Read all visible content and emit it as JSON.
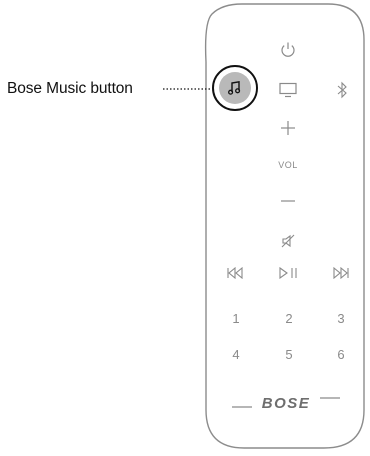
{
  "callout": {
    "label": "Bose Music button"
  },
  "remote": {
    "icons": {
      "power": "power-icon",
      "music": "music-note-icon",
      "tv": "tv-icon",
      "bluetooth": "bluetooth-icon",
      "volume_up": "plus-icon",
      "volume_down": "minus-icon",
      "mute": "mute-icon",
      "previous": "skip-back-icon",
      "play_pause": "play-pause-icon",
      "next": "skip-forward-icon"
    },
    "vol_label": "VOL",
    "presets": [
      "1",
      "2",
      "3",
      "4",
      "5",
      "6"
    ],
    "brand": "BOSE"
  },
  "colors": {
    "outline": "#8c8c8c",
    "icon": "#8a8a8a",
    "highlight_fill": "#b9b9b9",
    "highlight_ring": "#111111"
  }
}
